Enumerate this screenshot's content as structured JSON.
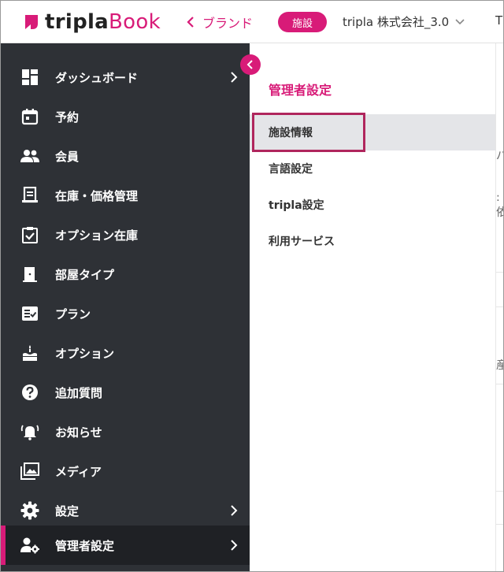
{
  "header": {
    "logo_text_dark": "tripla",
    "logo_text_accent": "Book",
    "brand_link": "ブランド",
    "facility_badge": "施設",
    "company_selector": "tripla 株式会社_3.0",
    "clipped_text": "T"
  },
  "sidebar": {
    "items": [
      {
        "label": "ダッシュボード",
        "icon": "dashboard-icon",
        "has_chevron": true
      },
      {
        "label": "予約",
        "icon": "calendar-icon",
        "has_chevron": false
      },
      {
        "label": "会員",
        "icon": "members-icon",
        "has_chevron": false
      },
      {
        "label": "在庫・価格管理",
        "icon": "inventory-icon",
        "has_chevron": false
      },
      {
        "label": "オプション在庫",
        "icon": "clipboard-check-icon",
        "has_chevron": false
      },
      {
        "label": "部屋タイプ",
        "icon": "door-icon",
        "has_chevron": false
      },
      {
        "label": "プラン",
        "icon": "plan-icon",
        "has_chevron": false
      },
      {
        "label": "オプション",
        "icon": "cake-icon",
        "has_chevron": false
      },
      {
        "label": "追加質問",
        "icon": "help-icon",
        "has_chevron": false
      },
      {
        "label": "お知らせ",
        "icon": "bell-icon",
        "has_chevron": false
      },
      {
        "label": "メディア",
        "icon": "media-icon",
        "has_chevron": false
      },
      {
        "label": "設定",
        "icon": "gear-icon",
        "has_chevron": true
      },
      {
        "label": "管理者設定",
        "icon": "admin-settings-icon",
        "has_chevron": true,
        "active": true
      }
    ]
  },
  "submenu": {
    "title": "管理者設定",
    "items": [
      {
        "label": "施設情報",
        "selected": true
      },
      {
        "label": "言語設定"
      },
      {
        "label": "tripla設定"
      },
      {
        "label": "利用サービス"
      }
    ]
  },
  "right_fragments": {
    "frag1": "パ",
    "frag2": ":依",
    "frag3": "産"
  },
  "colors": {
    "accent": "#d81b78",
    "sidebar_bg": "#2e3136",
    "sidebar_active_bg": "#1f2125",
    "highlight_border": "#b0265d"
  }
}
